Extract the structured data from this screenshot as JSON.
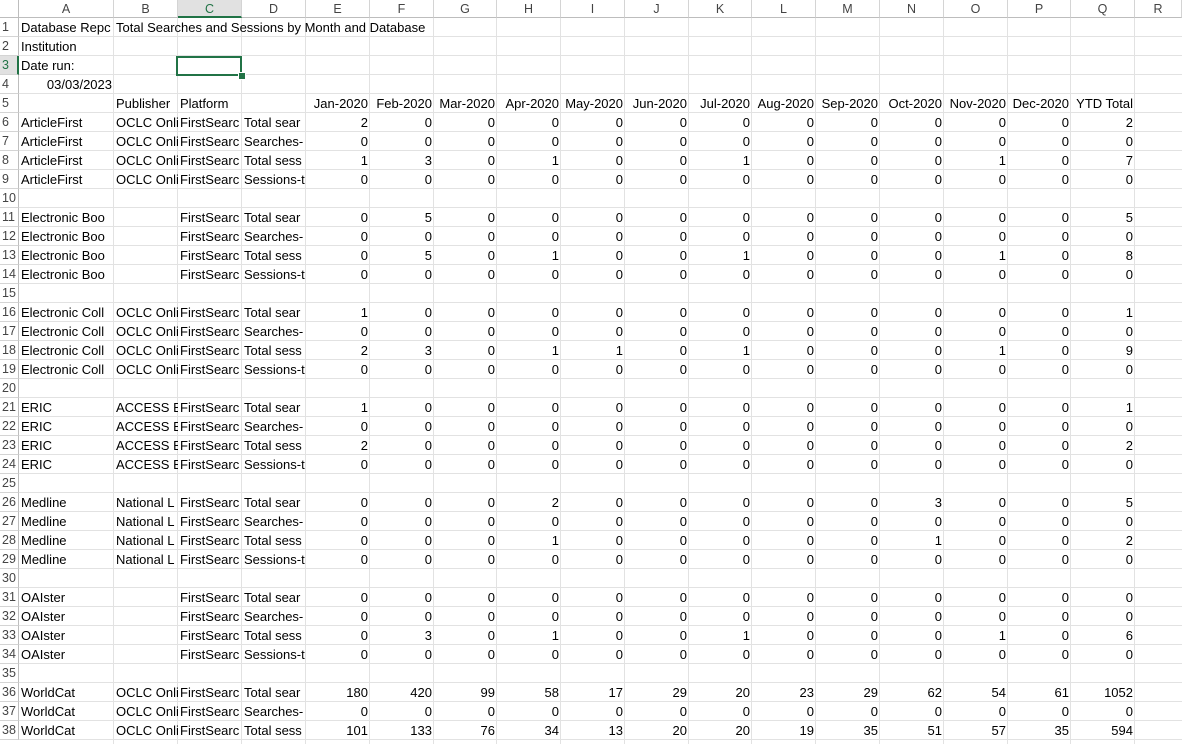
{
  "columns": [
    "A",
    "B",
    "C",
    "D",
    "E",
    "F",
    "G",
    "H",
    "I",
    "J",
    "K",
    "L",
    "M",
    "N",
    "O",
    "P",
    "Q",
    "R"
  ],
  "selected_column": "C",
  "selected_row": 3,
  "active_cell": "C3",
  "header_rows": {
    "r1": {
      "a": "Database Repc",
      "b": "Total Searches and Sessions by Month and Database"
    },
    "r2": {
      "a": "Institution"
    },
    "r3": {
      "a": "Date run:"
    },
    "r4": {
      "a": "03/03/2023"
    },
    "r5": {
      "b": "Publisher",
      "c": "Platform",
      "months": [
        "Jan-2020",
        "Feb-2020",
        "Mar-2020",
        "Apr-2020",
        "May-2020",
        "Jun-2020",
        "Jul-2020",
        "Aug-2020",
        "Sep-2020",
        "Oct-2020",
        "Nov-2020",
        "Dec-2020",
        "YTD Total"
      ]
    }
  },
  "rows": [
    {
      "n": 6,
      "a": "ArticleFirst",
      "b": "OCLC Onli",
      "c": "FirstSearc",
      "d": "Total sear",
      "v": [
        "2",
        "0",
        "0",
        "0",
        "0",
        "0",
        "0",
        "0",
        "0",
        "0",
        "0",
        "0",
        "2"
      ]
    },
    {
      "n": 7,
      "a": "ArticleFirst",
      "b": "OCLC Onli",
      "c": "FirstSearc",
      "d": "Searches-",
      "v": [
        "0",
        "0",
        "0",
        "0",
        "0",
        "0",
        "0",
        "0",
        "0",
        "0",
        "0",
        "0",
        "0"
      ]
    },
    {
      "n": 8,
      "a": "ArticleFirst",
      "b": "OCLC Onli",
      "c": "FirstSearc",
      "d": "Total sess",
      "v": [
        "1",
        "3",
        "0",
        "1",
        "0",
        "0",
        "1",
        "0",
        "0",
        "0",
        "1",
        "0",
        "7"
      ]
    },
    {
      "n": 9,
      "a": "ArticleFirst",
      "b": "OCLC Onli",
      "c": "FirstSearc",
      "d": "Sessions-t",
      "v": [
        "0",
        "0",
        "0",
        "0",
        "0",
        "0",
        "0",
        "0",
        "0",
        "0",
        "0",
        "0",
        "0"
      ]
    },
    {
      "n": 10,
      "blank": true
    },
    {
      "n": 11,
      "a": "Electronic Boo",
      "b": "",
      "c": "FirstSearc",
      "d": "Total sear",
      "v": [
        "0",
        "5",
        "0",
        "0",
        "0",
        "0",
        "0",
        "0",
        "0",
        "0",
        "0",
        "0",
        "5"
      ]
    },
    {
      "n": 12,
      "a": "Electronic Boo",
      "b": "",
      "c": "FirstSearc",
      "d": "Searches-",
      "v": [
        "0",
        "0",
        "0",
        "0",
        "0",
        "0",
        "0",
        "0",
        "0",
        "0",
        "0",
        "0",
        "0"
      ]
    },
    {
      "n": 13,
      "a": "Electronic Boo",
      "b": "",
      "c": "FirstSearc",
      "d": "Total sess",
      "v": [
        "0",
        "5",
        "0",
        "1",
        "0",
        "0",
        "1",
        "0",
        "0",
        "0",
        "1",
        "0",
        "8"
      ]
    },
    {
      "n": 14,
      "a": "Electronic Boo",
      "b": "",
      "c": "FirstSearc",
      "d": "Sessions-t",
      "v": [
        "0",
        "0",
        "0",
        "0",
        "0",
        "0",
        "0",
        "0",
        "0",
        "0",
        "0",
        "0",
        "0"
      ]
    },
    {
      "n": 15,
      "blank": true
    },
    {
      "n": 16,
      "a": "Electronic Coll",
      "b": "OCLC Onli",
      "c": "FirstSearc",
      "d": "Total sear",
      "v": [
        "1",
        "0",
        "0",
        "0",
        "0",
        "0",
        "0",
        "0",
        "0",
        "0",
        "0",
        "0",
        "1"
      ]
    },
    {
      "n": 17,
      "a": "Electronic Coll",
      "b": "OCLC Onli",
      "c": "FirstSearc",
      "d": "Searches-",
      "v": [
        "0",
        "0",
        "0",
        "0",
        "0",
        "0",
        "0",
        "0",
        "0",
        "0",
        "0",
        "0",
        "0"
      ]
    },
    {
      "n": 18,
      "a": "Electronic Coll",
      "b": "OCLC Onli",
      "c": "FirstSearc",
      "d": "Total sess",
      "v": [
        "2",
        "3",
        "0",
        "1",
        "1",
        "0",
        "1",
        "0",
        "0",
        "0",
        "1",
        "0",
        "9"
      ]
    },
    {
      "n": 19,
      "a": "Electronic Coll",
      "b": "OCLC Onli",
      "c": "FirstSearc",
      "d": "Sessions-t",
      "v": [
        "0",
        "0",
        "0",
        "0",
        "0",
        "0",
        "0",
        "0",
        "0",
        "0",
        "0",
        "0",
        "0"
      ]
    },
    {
      "n": 20,
      "blank": true
    },
    {
      "n": 21,
      "a": "ERIC",
      "b": "ACCESS EF",
      "c": "FirstSearc",
      "d": "Total sear",
      "v": [
        "1",
        "0",
        "0",
        "0",
        "0",
        "0",
        "0",
        "0",
        "0",
        "0",
        "0",
        "0",
        "1"
      ]
    },
    {
      "n": 22,
      "a": "ERIC",
      "b": "ACCESS EF",
      "c": "FirstSearc",
      "d": "Searches-",
      "v": [
        "0",
        "0",
        "0",
        "0",
        "0",
        "0",
        "0",
        "0",
        "0",
        "0",
        "0",
        "0",
        "0"
      ]
    },
    {
      "n": 23,
      "a": "ERIC",
      "b": "ACCESS EF",
      "c": "FirstSearc",
      "d": "Total sess",
      "v": [
        "2",
        "0",
        "0",
        "0",
        "0",
        "0",
        "0",
        "0",
        "0",
        "0",
        "0",
        "0",
        "2"
      ]
    },
    {
      "n": 24,
      "a": "ERIC",
      "b": "ACCESS EF",
      "c": "FirstSearc",
      "d": "Sessions-t",
      "v": [
        "0",
        "0",
        "0",
        "0",
        "0",
        "0",
        "0",
        "0",
        "0",
        "0",
        "0",
        "0",
        "0"
      ]
    },
    {
      "n": 25,
      "blank": true
    },
    {
      "n": 26,
      "a": "Medline",
      "b": "National L",
      "c": "FirstSearc",
      "d": "Total sear",
      "v": [
        "0",
        "0",
        "0",
        "2",
        "0",
        "0",
        "0",
        "0",
        "0",
        "3",
        "0",
        "0",
        "5"
      ]
    },
    {
      "n": 27,
      "a": "Medline",
      "b": "National L",
      "c": "FirstSearc",
      "d": "Searches-",
      "v": [
        "0",
        "0",
        "0",
        "0",
        "0",
        "0",
        "0",
        "0",
        "0",
        "0",
        "0",
        "0",
        "0"
      ]
    },
    {
      "n": 28,
      "a": "Medline",
      "b": "National L",
      "c": "FirstSearc",
      "d": "Total sess",
      "v": [
        "0",
        "0",
        "0",
        "1",
        "0",
        "0",
        "0",
        "0",
        "0",
        "1",
        "0",
        "0",
        "2"
      ]
    },
    {
      "n": 29,
      "a": "Medline",
      "b": "National L",
      "c": "FirstSearc",
      "d": "Sessions-t",
      "v": [
        "0",
        "0",
        "0",
        "0",
        "0",
        "0",
        "0",
        "0",
        "0",
        "0",
        "0",
        "0",
        "0"
      ]
    },
    {
      "n": 30,
      "blank": true
    },
    {
      "n": 31,
      "a": "OAIster",
      "b": "",
      "c": "FirstSearc",
      "d": "Total sear",
      "v": [
        "0",
        "0",
        "0",
        "0",
        "0",
        "0",
        "0",
        "0",
        "0",
        "0",
        "0",
        "0",
        "0"
      ]
    },
    {
      "n": 32,
      "a": "OAIster",
      "b": "",
      "c": "FirstSearc",
      "d": "Searches-",
      "v": [
        "0",
        "0",
        "0",
        "0",
        "0",
        "0",
        "0",
        "0",
        "0",
        "0",
        "0",
        "0",
        "0"
      ]
    },
    {
      "n": 33,
      "a": "OAIster",
      "b": "",
      "c": "FirstSearc",
      "d": "Total sess",
      "v": [
        "0",
        "3",
        "0",
        "1",
        "0",
        "0",
        "1",
        "0",
        "0",
        "0",
        "1",
        "0",
        "6"
      ]
    },
    {
      "n": 34,
      "a": "OAIster",
      "b": "",
      "c": "FirstSearc",
      "d": "Sessions-t",
      "v": [
        "0",
        "0",
        "0",
        "0",
        "0",
        "0",
        "0",
        "0",
        "0",
        "0",
        "0",
        "0",
        "0"
      ]
    },
    {
      "n": 35,
      "blank": true
    },
    {
      "n": 36,
      "a": "WorldCat",
      "b": "OCLC Onli",
      "c": "FirstSearc",
      "d": "Total sear",
      "v": [
        "180",
        "420",
        "99",
        "58",
        "17",
        "29",
        "20",
        "23",
        "29",
        "62",
        "54",
        "61",
        "1052"
      ]
    },
    {
      "n": 37,
      "a": "WorldCat",
      "b": "OCLC Onli",
      "c": "FirstSearc",
      "d": "Searches-",
      "v": [
        "0",
        "0",
        "0",
        "0",
        "0",
        "0",
        "0",
        "0",
        "0",
        "0",
        "0",
        "0",
        "0"
      ]
    },
    {
      "n": 38,
      "a": "WorldCat",
      "b": "OCLC Onli",
      "c": "FirstSearc",
      "d": "Total sess",
      "v": [
        "101",
        "133",
        "76",
        "34",
        "13",
        "20",
        "20",
        "19",
        "35",
        "51",
        "57",
        "35",
        "594"
      ]
    }
  ]
}
